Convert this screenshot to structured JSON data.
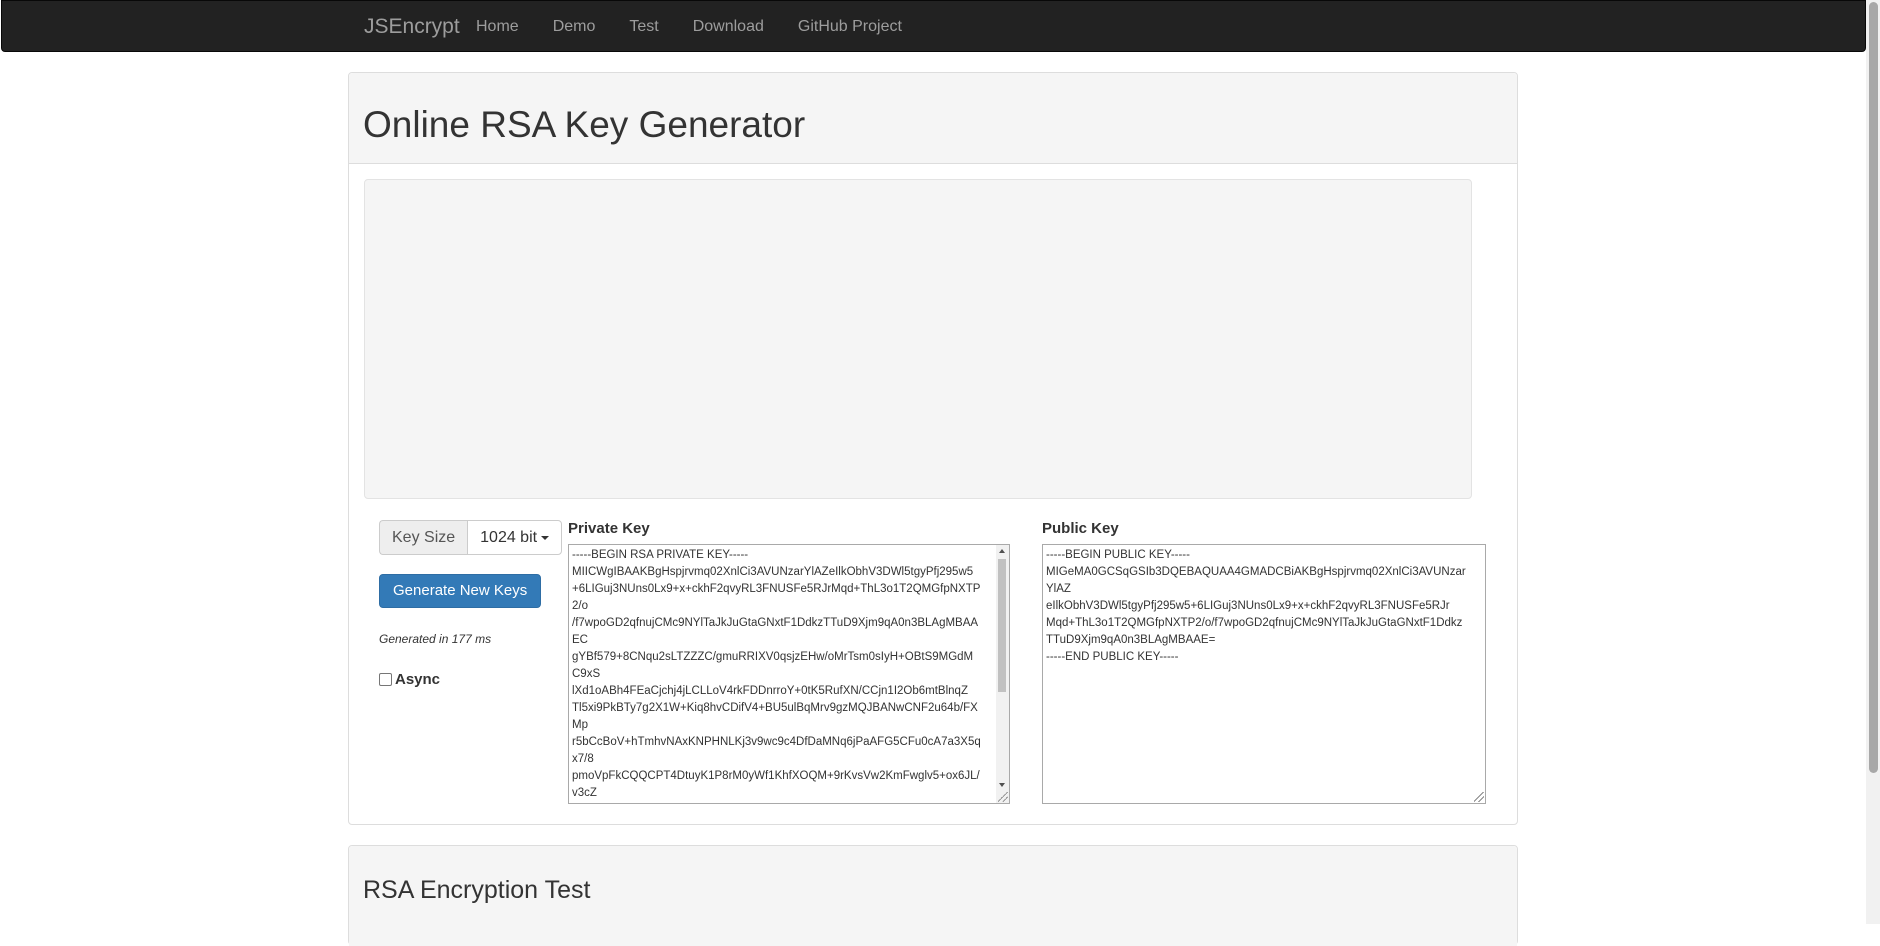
{
  "navbar": {
    "brand": "JSEncrypt",
    "links": [
      "Home",
      "Demo",
      "Test",
      "Download",
      "GitHub Project"
    ]
  },
  "generator": {
    "title": "Online RSA Key Generator",
    "key_size_label": "Key Size",
    "key_size_value": "1024 bit",
    "generate_button": "Generate New Keys",
    "generated_time": "Generated in 177 ms",
    "async_label": "Async",
    "async_checked": false,
    "private_key_label": "Private Key",
    "private_key_lines": [
      "-----BEGIN RSA PRIVATE KEY-----",
      "MIICWgIBAAKBgHspjrvmq02XnlCi3AVUNzarYlAZeIlkObhV3DWl5tgyPfj295w5",
      "+6LIGuj3NUns0Lx9+x+ckhF2qvyRL3FNUSFe5RJrMqd+ThL3o1T2QMGfpNXTP",
      "2/o",
      "/f7wpoGD2qfnujCMc9NYlTaJkJuGtaGNxtF1DdkzTTuD9Xjm9qA0n3BLAgMBAA",
      "EC",
      "gYBf579+8CNqu2sLTZZZC/gmuRRIXV0qsjzEHw/oMrTsm0sIyH+OBtS9MGdM",
      "C9xS",
      "lXd1oABh4FEaCjchj4jLCLLoV4rkFDDnrroY+0tK5RufXN/CCjn1I2Ob6mtBlnqZ",
      "Tl5xi9PkBTy7g2X1W+Kiq8hvCDifV4+BU5ulBqMrv9gzMQJBANwCNF2u64b/FX",
      "Mp",
      "r5bCcBoV+hTmhvNAxKNPHNLKj3v9wc9c4DfDaMNq6jPaAFG5CFu0cA7a3X5q",
      "x7/8",
      "pmoVpFkCQQCPT4DtuyK1P8rM0yWf1KhfXOQM+9rKvsVw2KmFwglv5+ox6JL/",
      "v3cZ"
    ],
    "public_key_label": "Public Key",
    "public_key_lines": [
      "-----BEGIN PUBLIC KEY-----",
      "MIGeMA0GCSqGSIb3DQEBAQUAA4GMADCBiAKBgHspjrvmq02XnlCi3AVUNzar",
      "YlAZ",
      "eIlkObhV3DWl5tgyPfj295w5+6LIGuj3NUns0Lx9+x+ckhF2qvyRL3FNUSFe5RJr",
      "Mqd+ThL3o1T2QMGfpNXTP2/o/f7wpoGD2qfnujCMc9NYlTaJkJuGtaGNxtF1Ddkz",
      "TTuD9Xjm9qA0n3BLAgMBAAE=",
      "-----END PUBLIC KEY-----"
    ]
  },
  "encryption_test": {
    "title": "RSA Encryption Test"
  }
}
